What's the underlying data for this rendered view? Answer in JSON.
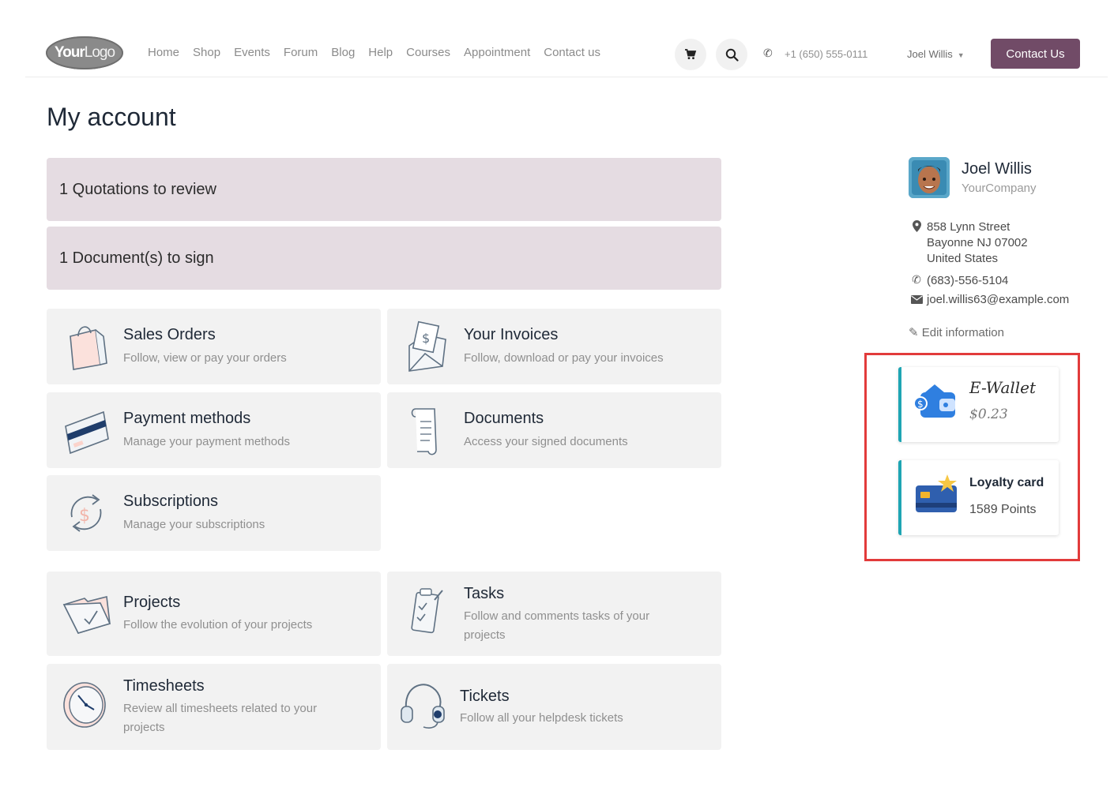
{
  "header": {
    "logo_bold": "Your",
    "logo_light": "Logo",
    "nav": [
      "Home",
      "Shop",
      "Events",
      "Forum",
      "Blog",
      "Help",
      "Courses",
      "Appointment",
      "Contact us"
    ],
    "phone": "+1 (650) 555-0111",
    "user": "Joel Willis",
    "contact_button": "Contact Us",
    "accent_color": "#714b67"
  },
  "page_title": "My account",
  "alerts": [
    "1 Quotations to review",
    "1 Document(s) to sign"
  ],
  "cards": [
    {
      "title": "Sales Orders",
      "desc": "Follow, view or pay your orders",
      "icon": "shopping-bag-icon"
    },
    {
      "title": "Your Invoices",
      "desc": "Follow, download or pay your invoices",
      "icon": "invoice-envelope-icon"
    },
    {
      "title": "Payment methods",
      "desc": "Manage your payment methods",
      "icon": "credit-card-icon"
    },
    {
      "title": "Documents",
      "desc": "Access your signed documents",
      "icon": "scroll-document-icon"
    },
    {
      "title": "Subscriptions",
      "desc": "Manage your subscriptions",
      "icon": "recurring-payment-icon"
    },
    {
      "title": "Projects",
      "desc": "Follow the evolution of your projects",
      "icon": "folder-check-icon"
    },
    {
      "title": "Tasks",
      "desc": "Follow and comments tasks of your projects",
      "icon": "task-checklist-icon"
    },
    {
      "title": "Timesheets",
      "desc": "Review all timesheets related to your projects",
      "icon": "clock-icon"
    },
    {
      "title": "Tickets",
      "desc": "Follow all your helpdesk tickets",
      "icon": "headset-icon"
    }
  ],
  "profile": {
    "name": "Joel Willis",
    "company": "YourCompany",
    "address": [
      "858 Lynn Street",
      "Bayonne NJ 07002",
      "United States"
    ],
    "phone": "(683)-556-5104",
    "email": "joel.willis63@example.com",
    "edit_label": "Edit information"
  },
  "widgets": {
    "wallet": {
      "title": "E-Wallet",
      "value": "$0.23"
    },
    "loyalty": {
      "title": "Loyalty card",
      "value": "1589 Points"
    },
    "accent_color": "#1ea5b3",
    "highlight_color": "#e23b3b"
  }
}
